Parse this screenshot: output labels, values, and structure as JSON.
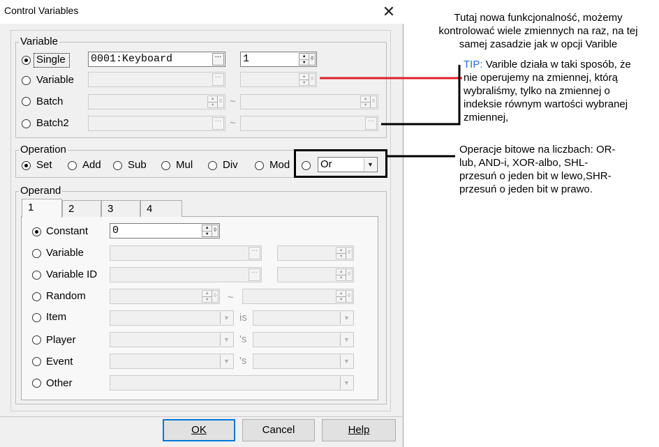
{
  "window": {
    "title": "Control Variables"
  },
  "variable_group": {
    "label": "Variable",
    "rows": [
      {
        "label": "Single",
        "selected": true,
        "value": "0001:Keyboard",
        "spin_value": "1"
      },
      {
        "label": "Variable",
        "selected": false,
        "value": "",
        "spin_value": ""
      },
      {
        "label": "Batch",
        "selected": false,
        "value": "",
        "range_sep": "~",
        "range_value": ""
      },
      {
        "label": "Batch2",
        "selected": false,
        "value": "",
        "range_sep": "~",
        "range_value": ""
      }
    ]
  },
  "operation_group": {
    "label": "Operation",
    "options": [
      "Set",
      "Add",
      "Sub",
      "Mul",
      "Div",
      "Mod"
    ],
    "selected": "Set",
    "bitwise_value": "Or"
  },
  "operand_group": {
    "label": "Operand",
    "tabs": [
      "1",
      "2",
      "3",
      "4"
    ],
    "active_tab": "1",
    "rows": [
      {
        "label": "Constant",
        "selected": true,
        "value": "0"
      },
      {
        "label": "Variable",
        "selected": false
      },
      {
        "label": "Variable ID",
        "selected": false
      },
      {
        "label": "Random",
        "selected": false,
        "sep": "~"
      },
      {
        "label": "Item",
        "selected": false,
        "sep": "is"
      },
      {
        "label": "Player",
        "selected": false,
        "sep": "'s"
      },
      {
        "label": "Event",
        "selected": false,
        "sep": "'s"
      },
      {
        "label": "Other",
        "selected": false
      }
    ]
  },
  "buttons": {
    "ok": "OK",
    "cancel": "Cancel",
    "help": "Help"
  },
  "annotations": {
    "intro": "Tutaj nowa funkcjonalność, możemy kontrolować wiele zmiennych na raz, na tej samej zasadzie jak w opcji Varible",
    "tip_label": "TIP:",
    "tip_text": "Varible działa w taki sposób, że nie operujemy na zmiennej, którą wybraliśmy, tylko na zmiennej o indeksie równym wartości wybranej zmiennej,",
    "bitwise": "Operacje bitowe na liczbach: OR-lub, AND-i, XOR-albo, SHL-przesuń o jeden bit w lewo,SHR-przesuń o jeden bit w prawo."
  },
  "colors": {
    "red_line": "#e0202a",
    "tip_label": "#1f6fd6",
    "default_button_border": "#0078d7"
  }
}
